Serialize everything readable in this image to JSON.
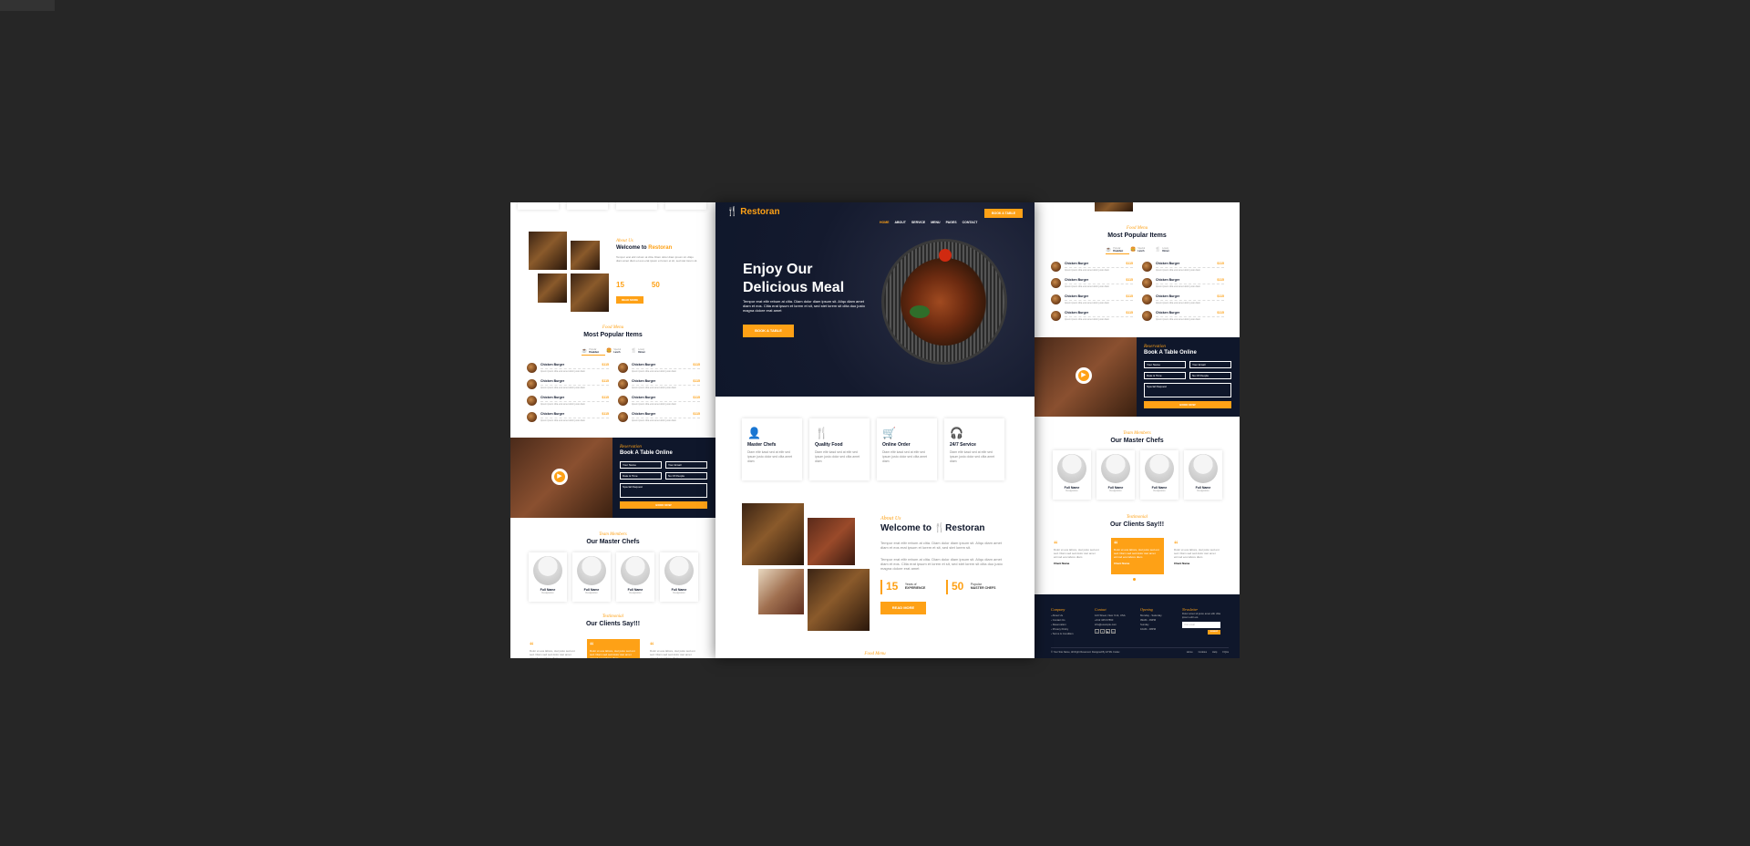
{
  "brand": {
    "name": "Restoran",
    "accent": "#FEA116",
    "dark": "#0F172B"
  },
  "nav": {
    "items": [
      "HOME",
      "ABOUT",
      "SERVICE",
      "MENU",
      "PAGES",
      "CONTACT"
    ],
    "cta": "BOOK A TABLE"
  },
  "hero": {
    "title_line1": "Enjoy Our",
    "title_line2": "Delicious Meal",
    "text": "Tempor erat elitr rebum at clita. Diam dolor diam ipsum sit. Aliqu diam amet diam et eos. Clita erat ipsum et lorem et sit, sed stet lorem sit clita duo justo magna dolore erat amet",
    "button": "BOOK A TABLE"
  },
  "services": [
    {
      "icon": "user-tie-icon",
      "title": "Master Chefs",
      "text": "Diam elitr kasd sed at elitr sed ipsum justo dolor sed clita amet diam"
    },
    {
      "icon": "utensils-icon",
      "title": "Quality Food",
      "text": "Diam elitr kasd sed at elitr sed ipsum justo dolor sed clita amet diam"
    },
    {
      "icon": "cart-icon",
      "title": "Online Order",
      "text": "Diam elitr kasd sed at elitr sed ipsum justo dolor sed clita amet diam"
    },
    {
      "icon": "headset-icon",
      "title": "24/7 Service",
      "text": "Diam elitr kasd sed at elitr sed ipsum justo dolor sed clita amet diam"
    }
  ],
  "about": {
    "subtitle": "About Us",
    "title_prefix": "Welcome to",
    "title_brand": "Restoran",
    "p1": "Tempor erat elitr rebum at clita. Diam dolor diam ipsum sit. Aliqu diam amet diam et eos erat ipsum et lorem et sit, sed stet lorem sit.",
    "p2": "Tempor erat elitr rebum at clita. Diam dolor diam ipsum sit. Aliqu diam amet diam et eos. Clita erat ipsum et lorem et sit, sed stet lorem sit clita duo justo magna dolore erat amet",
    "stat1_num": "15",
    "stat1_small": "Years of",
    "stat1_big": "EXPERIENCE",
    "stat2_num": "50",
    "stat2_small": "Popular",
    "stat2_big": "MASTER CHEFS",
    "button": "READ MORE"
  },
  "center_footer_peek": "Food Menu",
  "menu": {
    "subtitle": "Food Menu",
    "title": "Most Popular Items",
    "tabs": [
      {
        "small": "Popular",
        "big": "Breakfast"
      },
      {
        "small": "Special",
        "big": "Lunch"
      },
      {
        "small": "Lovely",
        "big": "Dinner"
      }
    ],
    "item_name": "Chicken Burger",
    "item_price": "$115",
    "item_desc": "Ipsum ipsum clita erat amet dolor justo diam"
  },
  "booking": {
    "subtitle": "Reservation",
    "title": "Book A Table Online",
    "fields": [
      "Your Name",
      "Your Email",
      "Date & Time",
      "No Of People",
      "Special Request"
    ],
    "button": "BOOK NOW"
  },
  "team": {
    "subtitle": "Team Members",
    "title": "Our Master Chefs",
    "name": "Full Name",
    "designation": "Designation"
  },
  "testimonial": {
    "subtitle": "Testimonial",
    "title": "Our Clients Say!!!",
    "text": "Dolor et eos labore, stet justo sed est sed. Diam sed sed dolor stet amet eirmod eos labore diam",
    "client": "Client Name",
    "profession": "Profession"
  },
  "footer": {
    "company_title": "Company",
    "company_links": [
      "About Us",
      "Contact Us",
      "Reservation",
      "Privacy Policy",
      "Terms & Condition"
    ],
    "contact_title": "Contact",
    "contact_lines": [
      "123 Street, New York, USA",
      "+012 345 67890",
      "info@example.com"
    ],
    "opening_title": "Opening",
    "opening_lines": [
      "Monday - Saturday",
      "09AM - 09PM",
      "Sunday",
      "10AM - 08PM"
    ],
    "newsletter_title": "Newsletter",
    "newsletter_text": "Dolor amet sit justo amet elitr clita ipsum elitr est.",
    "newsletter_placeholder": "Your email",
    "newsletter_button": "SIGNUP",
    "copyright": "© Your Site Name, All Right Reserved. Designed By HTML Codex",
    "bottom_links": [
      "Home",
      "Cookies",
      "Help",
      "FQAs"
    ]
  }
}
